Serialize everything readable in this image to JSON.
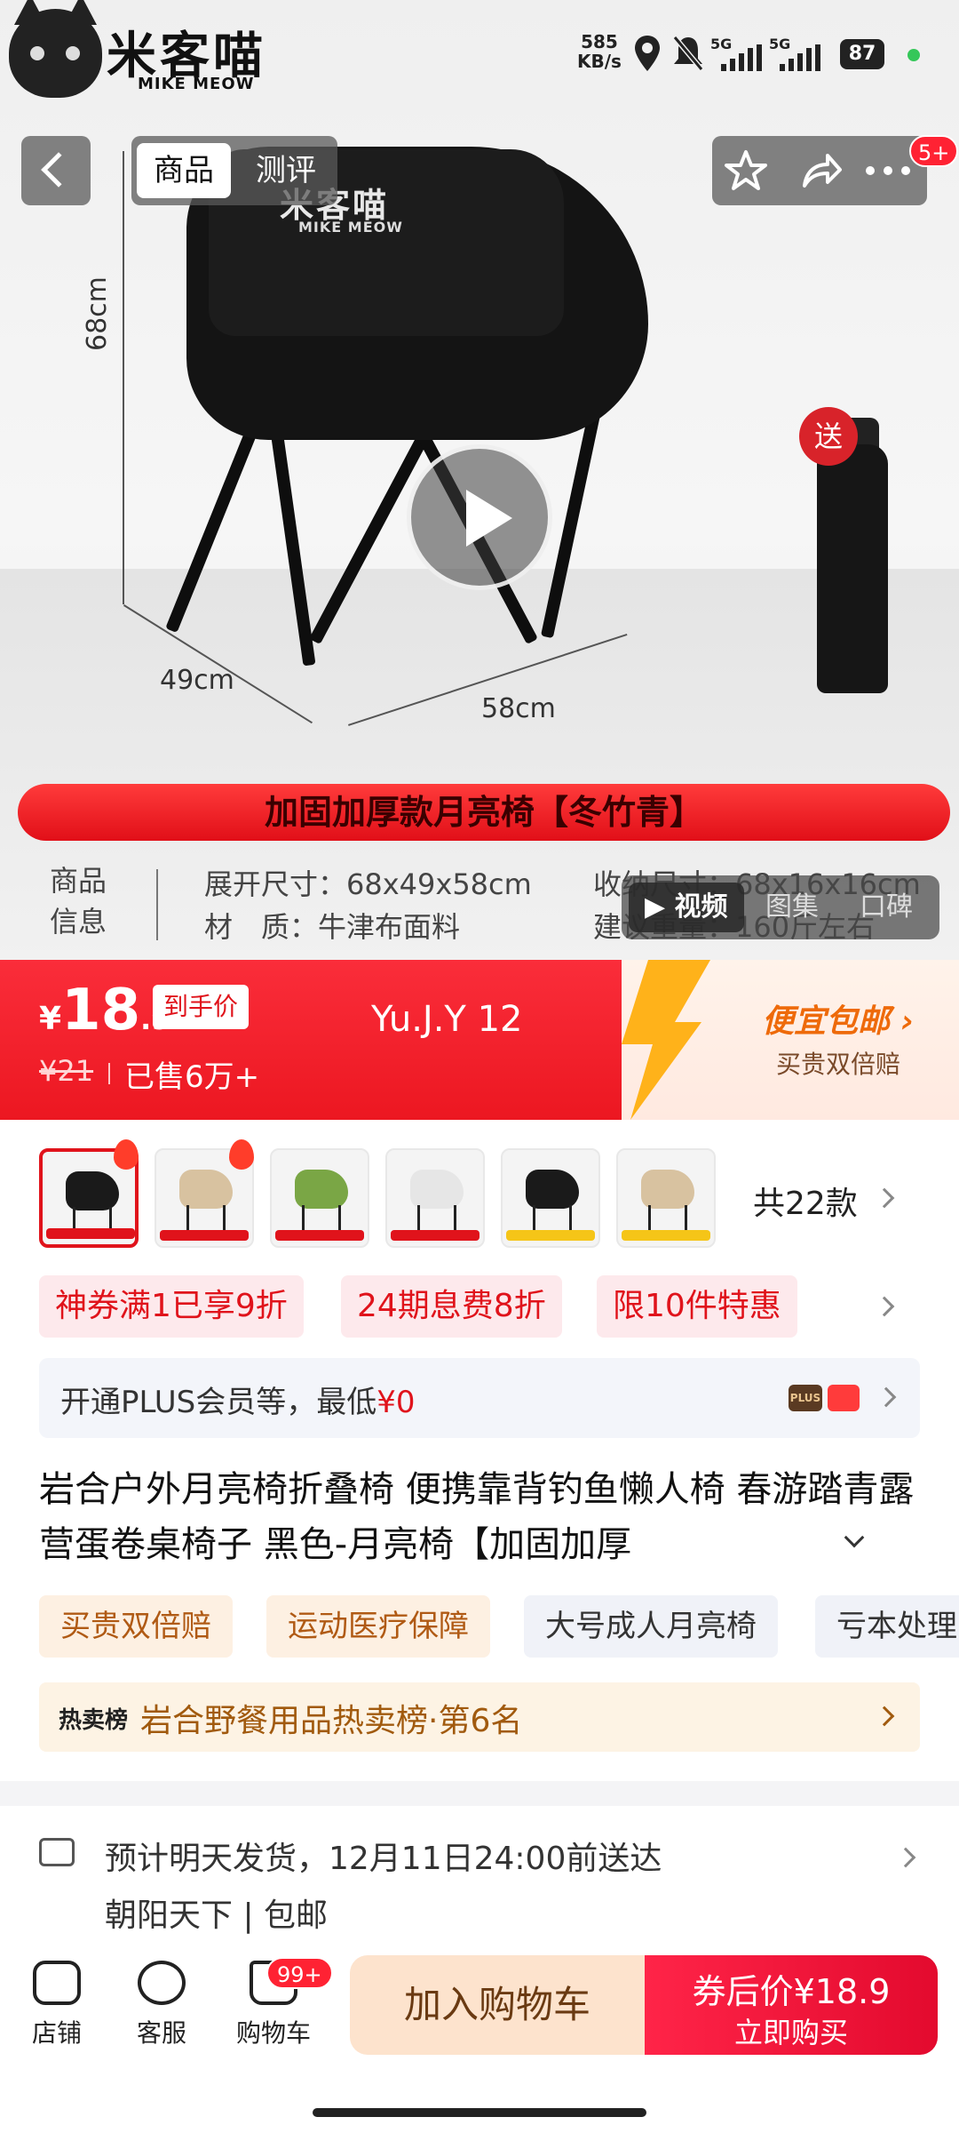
{
  "status_bar": {
    "logo_text": "米客喵",
    "logo_sub": "MIKE MEOW",
    "net_speed_value": "585",
    "net_speed_unit": "KB/s",
    "signal1": "5G",
    "signal2": "5G",
    "battery": "87"
  },
  "top_nav": {
    "tabs": [
      "商品",
      "测评"
    ],
    "message_badge": "5+"
  },
  "hero": {
    "chair_brand": "米客喵",
    "chair_brand_sub": "MIKE MEOW",
    "dim_height": "68cm",
    "dim_depth": "49cm",
    "dim_width": "58cm",
    "gift_badge": "送",
    "variant_banner": "加固加厚款月亮椅【冬竹青】",
    "info_label": "商品\n信息",
    "info_lines": [
      "展开尺寸：68x49x58cm",
      "材　质：牛津布面料",
      "收纳尺寸：68x16x16cm",
      "建议重量：160斤左右"
    ],
    "media_tabs": [
      "视频",
      "图集",
      "口碑"
    ]
  },
  "price": {
    "currency": "¥",
    "integer": "18",
    "decimal": ".9",
    "tag": "到手价",
    "original": "¥21",
    "sold": "已售6万+",
    "username": "Yu.J.Y 12",
    "promo_title": "便宜包邮",
    "promo_sub": "买贵双倍赔"
  },
  "variants": {
    "count_label": "共22款",
    "colors": [
      "#1a1a1a",
      "#d8c2a0",
      "#7aa645",
      "#e6e6e6",
      "#1a1a1a",
      "#d8c2a0"
    ]
  },
  "coupons": [
    "神券满1已享9折",
    "24期息费8折",
    "限10件特惠"
  ],
  "plus": {
    "text": "开通PLUS会员等，最低",
    "amount": "¥0",
    "icon_label": "PLUS"
  },
  "title": "岩合户外月亮椅折叠椅 便携靠背钓鱼懒人椅  春游踏青露营蛋卷桌椅子 黑色-月亮椅【加固加厚",
  "tags": [
    "买贵双倍赔",
    "运动医疗保障",
    "大号成人月亮椅",
    "亏本处理"
  ],
  "ranking": {
    "badge": "热卖榜",
    "text": "岩合野餐用品热卖榜·第6名"
  },
  "delivery": {
    "line": "预计明天发货，12月11日24:00前送达",
    "sub": "朝阳天下 | 包邮"
  },
  "bottom_bar": {
    "store": "店铺",
    "service": "客服",
    "cart": "购物车",
    "cart_badge": "99+",
    "add_cart": "加入购物车",
    "buy_price": "券后价¥18.9",
    "buy_now": "立即购买"
  }
}
